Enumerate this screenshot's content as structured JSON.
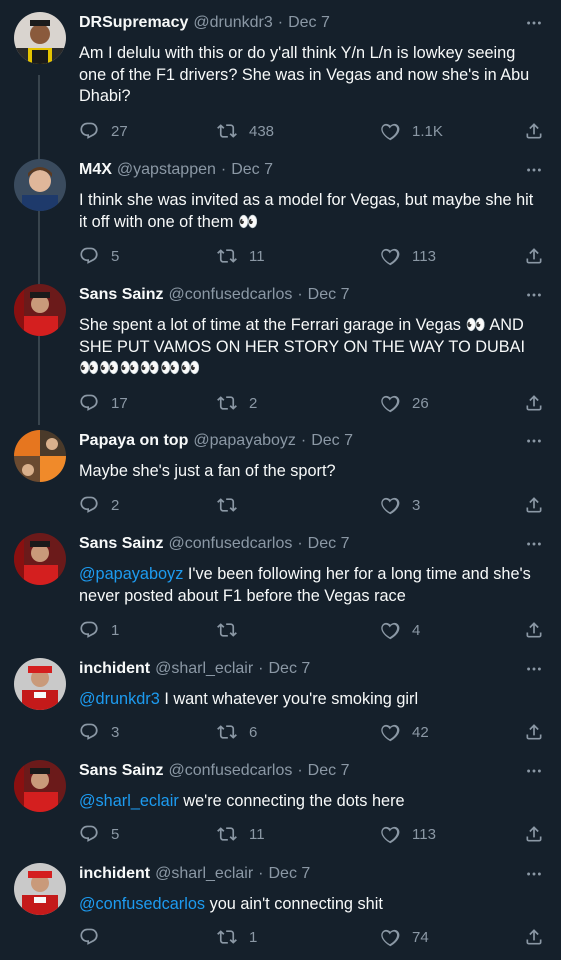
{
  "tweets": [
    {
      "name": "DRSupremacy",
      "handle": "@drunkdr3",
      "date": "Dec 7",
      "text_lines": [
        "Am I delulu with this or do y'all think Y/n L/n is lowkey seeing one of the F1 drivers? She was in Vegas and now she's in Abu Dhabi?"
      ],
      "mention": "",
      "body": "Am I delulu with this or do y'all think Y/n L/n is lowkey seeing one of the F1 drivers? She was in Vegas and now she's in Abu Dhabi?",
      "replies": "27",
      "retweets": "438",
      "likes": "1.1K"
    },
    {
      "name": "M4X",
      "handle": "@yapstappen",
      "date": "Dec 7",
      "mention": "",
      "body": "I think she was invited as a model for Vegas, but maybe she hit it off with one of them 👀",
      "replies": "5",
      "retweets": "11",
      "likes": "113"
    },
    {
      "name": "Sans Sainz",
      "handle": "@confusedcarlos",
      "date": "Dec 7",
      "mention": "",
      "body": "She spent a lot of time at the Ferrari garage in Vegas 👀 AND SHE PUT VAMOS ON HER STORY ON THE WAY TO DUBAI👀👀👀👀👀👀",
      "replies": "17",
      "retweets": "2",
      "likes": "26"
    },
    {
      "name": "Papaya on top",
      "handle": "@papayaboyz",
      "date": "Dec 7",
      "mention": "",
      "body": "Maybe she's just a fan of the sport?",
      "replies": "2",
      "retweets": "",
      "likes": "3"
    },
    {
      "name": "Sans Sainz",
      "handle": "@confusedcarlos",
      "date": "Dec 7",
      "mention": "@papayaboyz",
      "body": " I've been following her for a long time and she's never posted about F1 before the Vegas race",
      "replies": "1",
      "retweets": "",
      "likes": "4"
    },
    {
      "name": "inchident",
      "handle": "@sharl_eclair",
      "date": "Dec 7",
      "mention": "@drunkdr3",
      "body": " I want whatever you're smoking girl",
      "replies": "3",
      "retweets": "6",
      "likes": "42"
    },
    {
      "name": "Sans Sainz",
      "handle": "@confusedcarlos",
      "date": "Dec 7",
      "mention": "@sharl_eclair",
      "body": " we're connecting the dots here",
      "replies": "5",
      "retweets": "11",
      "likes": "113"
    },
    {
      "name": "inchident",
      "handle": "@sharl_eclair",
      "date": "Dec 7",
      "mention": "@confusedcarlos",
      "body": " you ain't connecting shit",
      "replies": "",
      "retweets": "1",
      "likes": "74"
    }
  ],
  "dot": "·",
  "icons": {
    "reply": "reply-icon",
    "retweet": "retweet-icon",
    "like": "heart-icon",
    "share": "share-icon",
    "more": "more-icon"
  },
  "colors": {
    "background": "#15202b",
    "text": "#f7f9f9",
    "muted": "#8b98a5",
    "link": "#1d9bf0",
    "line": "#38444d"
  }
}
